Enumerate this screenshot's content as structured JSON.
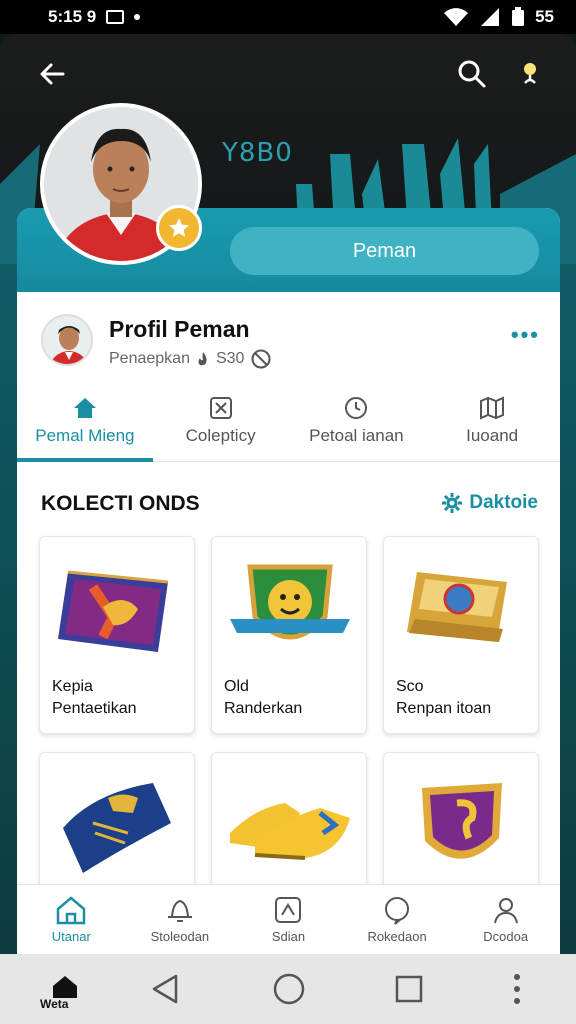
{
  "status_bar": {
    "time": "5:15 9",
    "battery": "55"
  },
  "header": {
    "banner_text": "Y8B0"
  },
  "card": {
    "pill_button": "Peman",
    "profile_name": "Profil Peman",
    "profile_sub": "Penaepkan",
    "profile_count": "S30"
  },
  "tabs": [
    {
      "label": "Pemal Mieng",
      "icon": "home-icon"
    },
    {
      "label": "Colepticy",
      "icon": "collection-icon"
    },
    {
      "label": "Petoal ianan",
      "icon": "clock-icon"
    },
    {
      "label": "Iuoand",
      "icon": "map-icon"
    }
  ],
  "section": {
    "title": "KOLECTI ONDS",
    "action": "Daktoie"
  },
  "items": [
    {
      "line1": "Kepia",
      "line2": "Pentaetikan"
    },
    {
      "line1": "Old",
      "line2": "Randerkan"
    },
    {
      "line1": "Sco",
      "line2": "Renpan itoan"
    },
    {
      "line1": "",
      "line2": ""
    },
    {
      "line1": "",
      "line2": ""
    },
    {
      "line1": "",
      "line2": ""
    }
  ],
  "bottom_nav": [
    {
      "label": "Utanar",
      "icon": "home-icon"
    },
    {
      "label": "Stoleodan",
      "icon": "bell-icon"
    },
    {
      "label": "Sdian",
      "icon": "tag-icon"
    },
    {
      "label": "Rokedaon",
      "icon": "chat-icon"
    },
    {
      "label": "Dcodoa",
      "icon": "user-icon"
    }
  ],
  "system_nav": {
    "home_label": "Weta"
  },
  "colors": {
    "accent": "#1a8ea3",
    "header_teal": "#1a9bb0",
    "badge": "#f2b630"
  }
}
